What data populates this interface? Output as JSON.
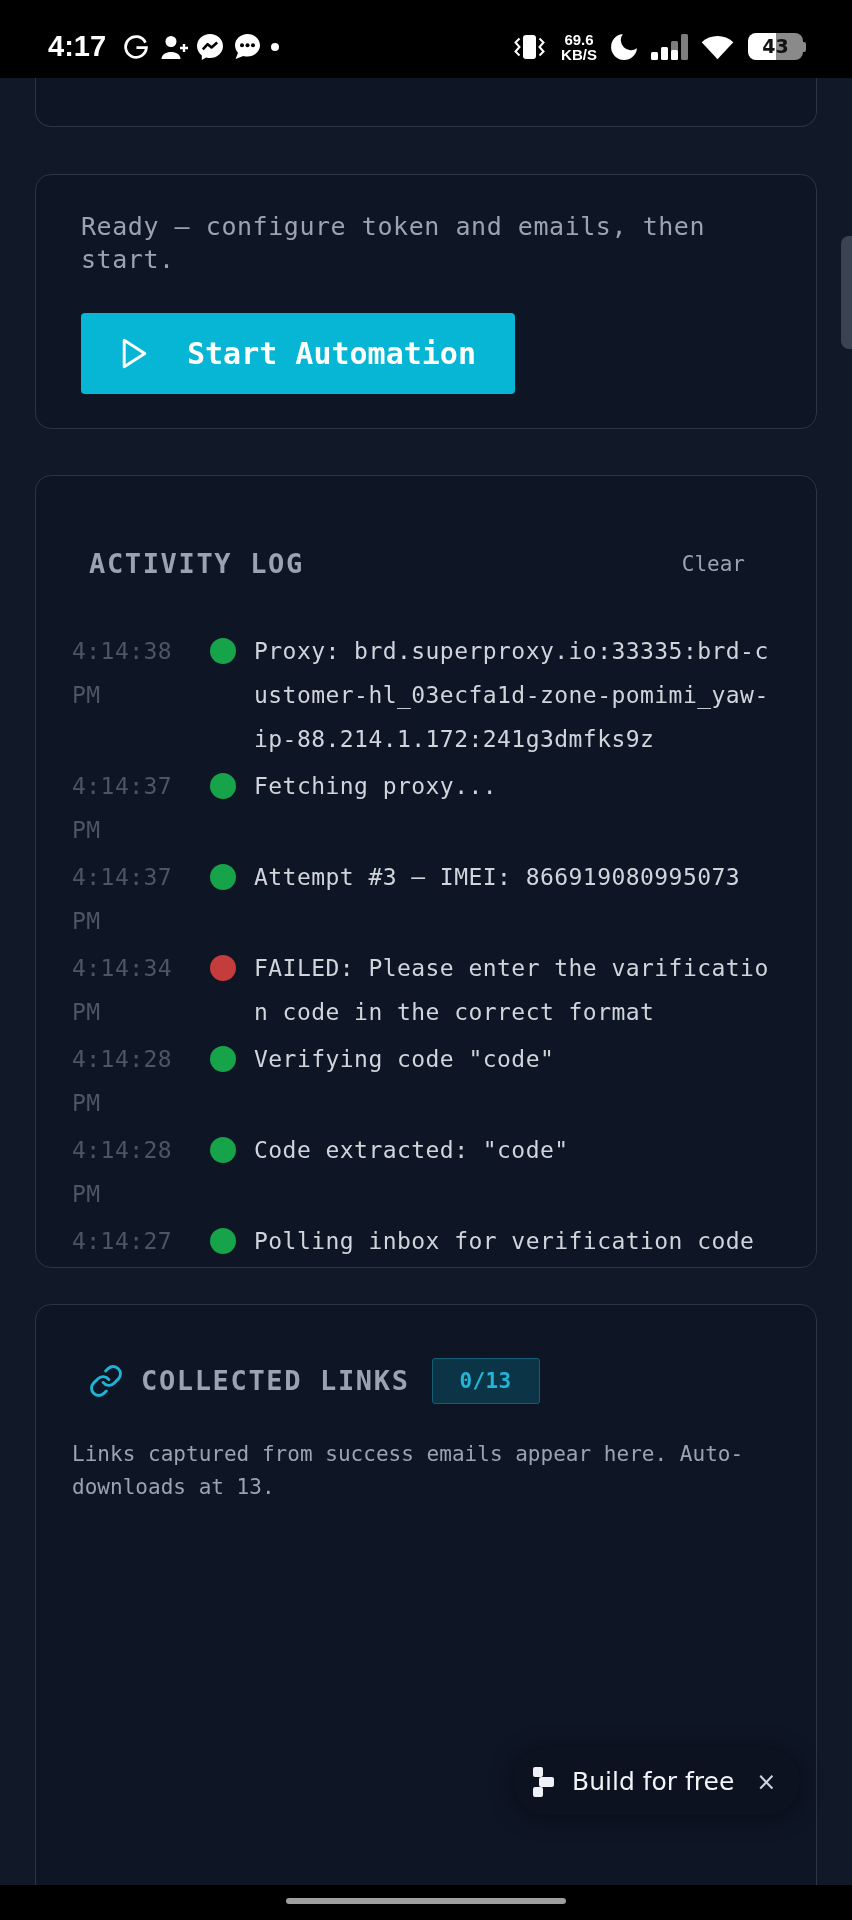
{
  "status_bar": {
    "time": "4:17",
    "network_speed": "69.6",
    "network_speed_unit": "KB/S",
    "battery": "43"
  },
  "status_card": {
    "message": "Ready — configure token and emails, then start.",
    "start_button": "Start Automation"
  },
  "activity_log": {
    "title": "ACTIVITY LOG",
    "clear_button": "Clear",
    "entries": [
      {
        "time": "4:14:38 PM",
        "color": "#16a34a",
        "message": "Proxy: brd.superproxy.io:33335:brd-customer-hl_03ecfa1d-zone-pomimi_yaw-ip-88.214.1.172:241g3dmfks9z"
      },
      {
        "time": "4:14:37 PM",
        "color": "#16a34a",
        "message": "Fetching proxy..."
      },
      {
        "time": "4:14:37 PM",
        "color": "#16a34a",
        "message": "Attempt #3 — IMEI: 866919080995073"
      },
      {
        "time": "4:14:34 PM",
        "color": "#c43c3c",
        "message": "FAILED: Please enter the varification code in the correct format"
      },
      {
        "time": "4:14:28 PM",
        "color": "#16a34a",
        "message": "Verifying code \"code\""
      },
      {
        "time": "4:14:28 PM",
        "color": "#16a34a",
        "message": "Code extracted: \"code\""
      },
      {
        "time": "4:14:27",
        "color": "#16a34a",
        "message": "Polling inbox for verification code"
      }
    ]
  },
  "collected_links": {
    "title": "COLLECTED LINKS",
    "count": "0/13",
    "description": "Links captured from success emails appear here. Auto-downloads at 13."
  },
  "promo_banner": {
    "label": "Build for free",
    "close": "×"
  }
}
